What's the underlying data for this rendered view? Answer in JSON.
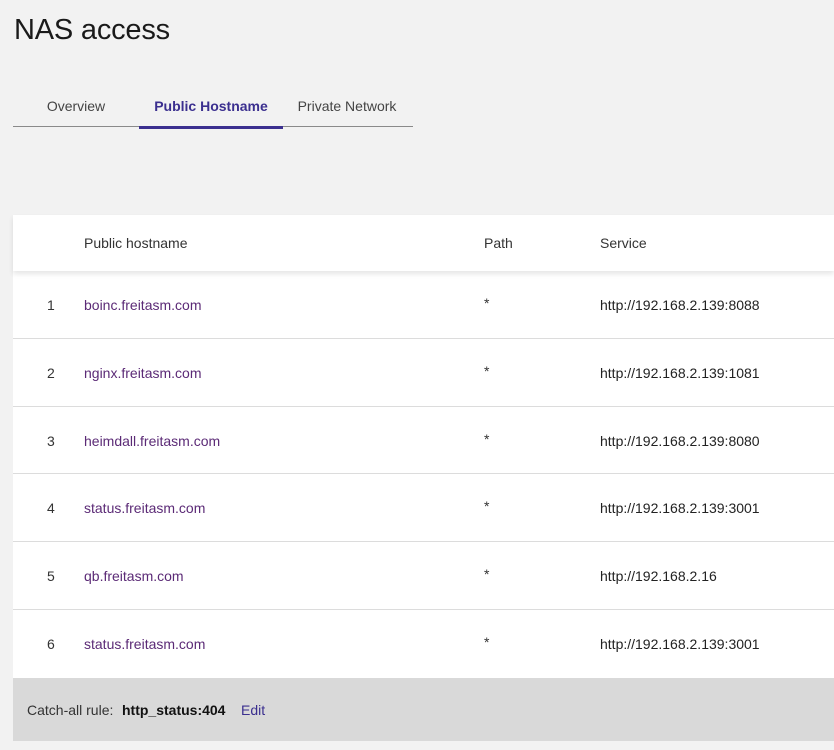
{
  "page": {
    "title": "NAS access"
  },
  "tabs": [
    {
      "label": "Overview",
      "active": false
    },
    {
      "label": "Public Hostname",
      "active": true
    },
    {
      "label": "Private Network",
      "active": false
    }
  ],
  "table": {
    "headers": {
      "hostname": "Public hostname",
      "path": "Path",
      "service": "Service"
    },
    "rows": [
      {
        "num": "1",
        "hostname": "boinc.freitasm.com",
        "path": "*",
        "service": "http://192.168.2.139:8088"
      },
      {
        "num": "2",
        "hostname": "nginx.freitasm.com",
        "path": "*",
        "service": "http://192.168.2.139:1081"
      },
      {
        "num": "3",
        "hostname": "heimdall.freitasm.com",
        "path": "*",
        "service": "http://192.168.2.139:8080"
      },
      {
        "num": "4",
        "hostname": "status.freitasm.com",
        "path": "*",
        "service": "http://192.168.2.139:3001"
      },
      {
        "num": "5",
        "hostname": "qb.freitasm.com",
        "path": "*",
        "service": "http://192.168.2.16"
      },
      {
        "num": "6",
        "hostname": "status.freitasm.com",
        "path": "*",
        "service": "http://192.168.2.139:3001"
      }
    ]
  },
  "catch_all": {
    "label": "Catch-all rule:",
    "value": "http_status:404",
    "edit_label": "Edit"
  },
  "colors": {
    "accent": "#3b2f8f",
    "link": "#5b2a76",
    "background": "#f2f2f2",
    "footer": "#d9d9d9"
  }
}
